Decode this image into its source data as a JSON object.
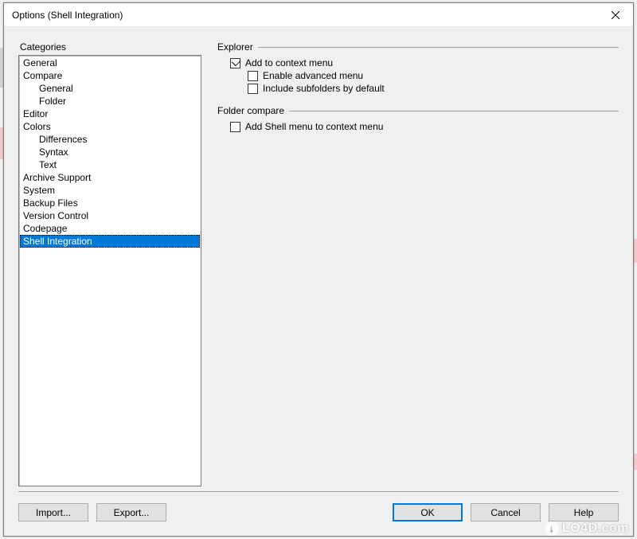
{
  "titlebar": {
    "title": "Options (Shell Integration)"
  },
  "categories": {
    "label": "Categories",
    "items": [
      {
        "label": "General",
        "indent": false,
        "selected": false
      },
      {
        "label": "Compare",
        "indent": false,
        "selected": false
      },
      {
        "label": "General",
        "indent": true,
        "selected": false
      },
      {
        "label": "Folder",
        "indent": true,
        "selected": false
      },
      {
        "label": "Editor",
        "indent": false,
        "selected": false
      },
      {
        "label": "Colors",
        "indent": false,
        "selected": false
      },
      {
        "label": "Differences",
        "indent": true,
        "selected": false
      },
      {
        "label": "Syntax",
        "indent": true,
        "selected": false
      },
      {
        "label": "Text",
        "indent": true,
        "selected": false
      },
      {
        "label": "Archive Support",
        "indent": false,
        "selected": false
      },
      {
        "label": "System",
        "indent": false,
        "selected": false
      },
      {
        "label": "Backup Files",
        "indent": false,
        "selected": false
      },
      {
        "label": "Version Control",
        "indent": false,
        "selected": false
      },
      {
        "label": "Codepage",
        "indent": false,
        "selected": false
      },
      {
        "label": "Shell Integration",
        "indent": false,
        "selected": true
      }
    ]
  },
  "settings": {
    "group1": {
      "title": "Explorer",
      "check1": {
        "label": "Add to context menu",
        "checked": true
      },
      "check2": {
        "label": "Enable advanced menu",
        "checked": false
      },
      "check3": {
        "label": "Include subfolders by default",
        "checked": false
      }
    },
    "group2": {
      "title": "Folder compare",
      "check1": {
        "label": "Add Shell menu to context menu",
        "checked": false
      }
    }
  },
  "buttons": {
    "import": "Import...",
    "export": "Export...",
    "ok": "OK",
    "cancel": "Cancel",
    "help": "Help"
  },
  "watermark": "LO4D.com"
}
